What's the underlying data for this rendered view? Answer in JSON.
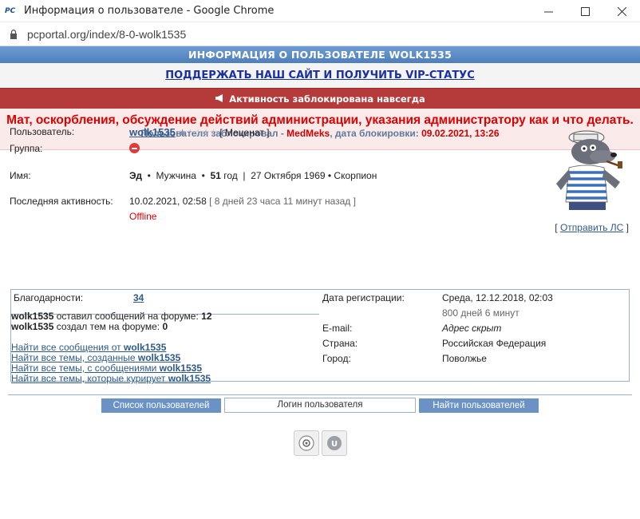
{
  "window": {
    "app_icon_text": "PC",
    "title": "Информация о пользователе - Google Chrome",
    "url": "pcportal.org/index/8-0-wolk1535"
  },
  "header": {
    "info_title": "ИНФОРМАЦИЯ О ПОЛЬЗОВАТЕЛЕ WOLK1535",
    "vip_link": "ПОДДЕРЖАТЬ НАШ САЙТ И ПОЛУЧИТЬ VIP-СТАТУС",
    "block_notice": "Активность заблокирована навсегда",
    "ban_reason": "Мат, оскорбления, обсуждение действий администрации, указания администратору как и что делать.",
    "ban_by_label": "Пользователя заблокировал - ",
    "ban_by": "MedMeks",
    "ban_date_label": ", дата блокировки: ",
    "ban_date": "09.02.2021, 13:26"
  },
  "profile": {
    "user_label": "Пользователь:",
    "username": "wolk1535",
    "rating_stars": 1,
    "rank": "[ Меценат ]",
    "group_label": "Группа:",
    "name_label": "Имя:",
    "name": "Эд",
    "gender": "Мужчина",
    "age": "51",
    "age_unit": "год",
    "birth_date": "27 Октября 1969",
    "zodiac": "Скорпион",
    "activity_label": "Последняя активность:",
    "last_activity": "10.02.2021, 02:58",
    "last_activity_ago": "[ 8 дней 23 часа 11 минут назад ]",
    "status": "Offline",
    "send_pm_open": "[ ",
    "send_pm": "Отправить ЛС",
    "send_pm_close": " ]"
  },
  "stats": {
    "thanks_label": "Благодарности:",
    "thanks_count": "34",
    "posts_user": "wolk1535",
    "posts_text": " оставил сообщений на форуме: ",
    "posts_count": "12",
    "topics_user": "wolk1535",
    "topics_text": " создал тем на форуме: ",
    "topics_count": "0",
    "links": [
      {
        "text": "Найти все сообщения от ",
        "user": "wolk1535"
      },
      {
        "text": "Найти все темы, созданные ",
        "user": "wolk1535"
      },
      {
        "text": "Найти все темы, с сообщениями ",
        "user": "wolk1535"
      },
      {
        "text": "Найти все темы, которые курирует ",
        "user": "wolk1535"
      }
    ],
    "reg_label": "Дата регистрации:",
    "reg_date": "Среда, 12.12.2018, 02:03",
    "reg_ago": "800 дней 6 минут",
    "email_label": "E-mail:",
    "email": "Адрес скрыт",
    "country_label": "Страна:",
    "country": "Российская Федерация",
    "city_label": "Город:",
    "city": "Поволжье"
  },
  "footer": {
    "users_list_button": "Список пользователей",
    "login_placeholder": "Логин пользователя",
    "find_users_button": "Найти пользователей"
  },
  "colors": {
    "header_blue": "#5b89c6",
    "block_red": "#b53a3a",
    "ban_text_red": "#e00000",
    "link_blue": "#2e5a8a"
  }
}
